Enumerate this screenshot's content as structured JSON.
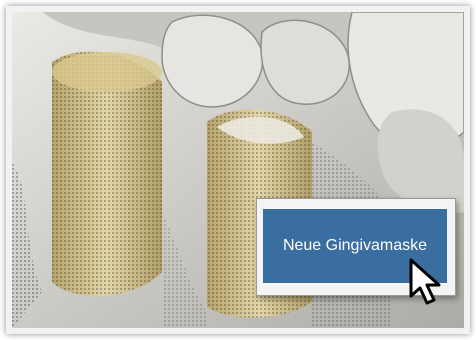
{
  "context_menu": {
    "items": [
      {
        "label": "Neue Gingivamaske"
      }
    ]
  },
  "icons": {
    "cursor": "mouse-pointer-icon"
  },
  "colors": {
    "menu_item_bg": "#3a6ea0",
    "menu_item_text": "#ffffff",
    "abutment_fill": "#c9b77e"
  }
}
